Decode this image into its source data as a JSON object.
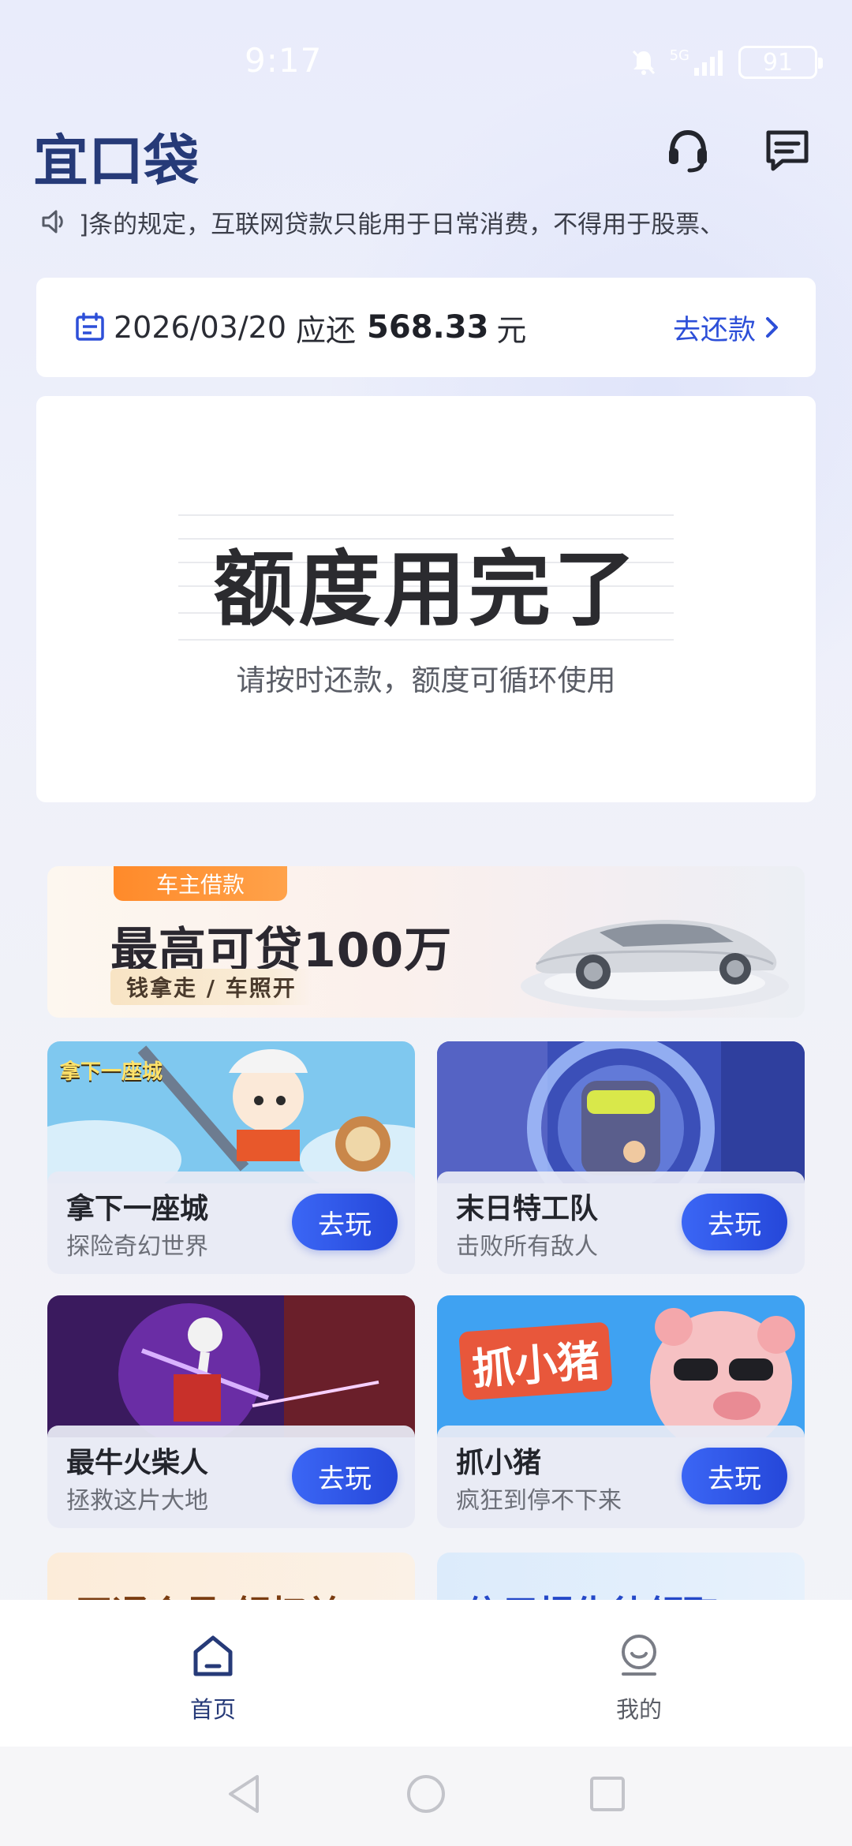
{
  "status_bar": {
    "time": "9:17",
    "network": "5G",
    "battery": "91"
  },
  "header": {
    "logo": "宜口袋",
    "support_icon": "headset-icon",
    "message_icon": "message-icon"
  },
  "notice": {
    "icon": "speaker-icon",
    "text": "]条的规定，互联网贷款只能用于日常消费，不得用于股票、"
  },
  "repay": {
    "date": "2026/03/20",
    "label": "应还",
    "amount": "568.33",
    "unit": "元",
    "action": "去还款"
  },
  "quota": {
    "title": "额度用完了",
    "subtitle": "请按时还款，额度可循环使用"
  },
  "banner": {
    "tag": "车主借款",
    "title": "最高可贷100万",
    "subtitle": "钱拿走 / 车照开"
  },
  "games": [
    {
      "name": "拿下一座城",
      "desc": "探险奇幻世界",
      "button": "去玩",
      "art_label": "拿下一座城"
    },
    {
      "name": "末日特工队",
      "desc": "击败所有敌人",
      "button": "去玩"
    },
    {
      "name": "最牛火柴人",
      "desc": "拯救这片大地",
      "button": "去玩"
    },
    {
      "name": "抓小猪",
      "desc": "疯狂到停不下来",
      "button": "去玩",
      "art_label": "抓小猪"
    }
  ],
  "partial_cards": [
    {
      "text": "开通会员 领权益"
    },
    {
      "text": "信用报告待领取"
    }
  ],
  "bottom_nav": [
    {
      "label": "首页",
      "icon": "home-icon",
      "active": true
    },
    {
      "label": "我的",
      "icon": "profile-icon",
      "active": false
    }
  ],
  "colors": {
    "accent": "#2d4fd8",
    "nav_icon": "#263a78",
    "nav_inactive": "#7a7d86"
  }
}
